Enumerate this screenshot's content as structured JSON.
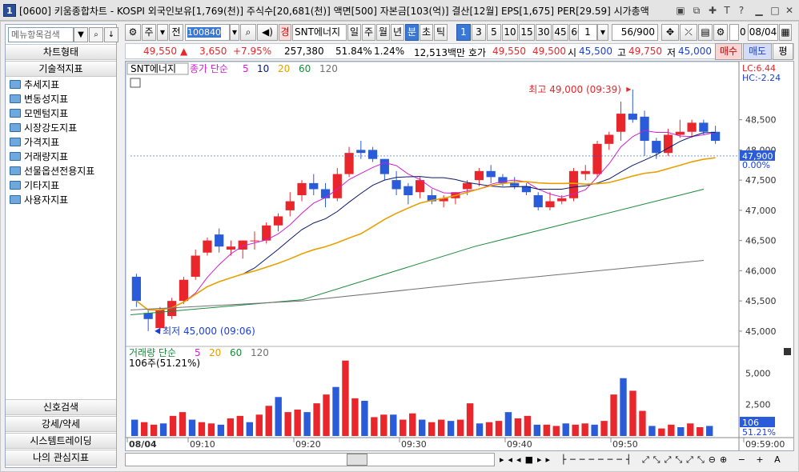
{
  "window": {
    "title": "[0600] 키움종합차트 - KOSPI 외국인보유[1,769(천)] 주식수[20,681(천)] 액면[500] 자본금[103(억)] 결산[12월] EPS[1,675] PER[29.59] 시가총액",
    "icon": "1"
  },
  "sidebar": {
    "search_placeholder": "메뉴항목검색",
    "section_chart_type": "차트형태",
    "section_tech": "기술적지표",
    "items": [
      "추세지표",
      "변동성지표",
      "모멘텀지표",
      "시장강도지표",
      "가격지표",
      "거래량지표",
      "선물옵션전용지표",
      "기타지표",
      "사용자지표"
    ],
    "bottom": [
      "신호검색",
      "강세/약세",
      "시스템트레이딩",
      "나의 관심지표"
    ]
  },
  "toolbar": {
    "period_labels": [
      "주",
      "전"
    ],
    "code": "100840",
    "stock_name": "SNT에너지",
    "gyeong": "경",
    "intervals": [
      "일",
      "주",
      "월",
      "년",
      "분",
      "초",
      "틱"
    ],
    "active_interval": "분",
    "minutes": [
      "1",
      "3",
      "5",
      "10",
      "15",
      "30",
      "45",
      "60"
    ],
    "active_minute": "1",
    "unit": "1",
    "count": "56/900",
    "zero": "0",
    "date": "08/04"
  },
  "quote": {
    "price": "49,550",
    "arrow": "▲",
    "change": "3,650",
    "pct": "+7.95%",
    "volume": "257,380",
    "turnover": "51.84%",
    "ratio": "1.24%",
    "amount": "12,513백만",
    "hoga_label": "호가",
    "ask": "49,550",
    "bid": "49,500",
    "open_label": "시",
    "open": "45,500",
    "high_label": "고",
    "high": "49,750",
    "low_label": "저",
    "low": "45,000",
    "buy": "매수",
    "sell": "매도",
    "eval": "평"
  },
  "chart": {
    "stock": "SNT에너지",
    "legend_label": "종가 단순",
    "ma": [
      "5",
      "10",
      "20",
      "60",
      "120"
    ],
    "ma_colors": [
      "#d020d0",
      "#0a1a6a",
      "#e8a000",
      "#1a8a3a",
      "#707070"
    ],
    "high_annotation": "최고 49,000 (09:39)",
    "low_annotation": "최저 45,000 (09:06)",
    "lc": "LC:6.44",
    "hc": "HC:-2.24",
    "cur_price": "47,900",
    "cur_pct": "0.00%",
    "y_ticks": [
      "48,500",
      "48,000",
      "47,500",
      "47,000",
      "46,500",
      "46,000",
      "45,500",
      "45,000"
    ],
    "vol_legend": "거래량 단순",
    "vol_ma": [
      "5",
      "20",
      "60",
      "120"
    ],
    "vol_note": "106주(51.21%)",
    "vol_ticks": [
      "5,000",
      "2,500"
    ],
    "vol_cur": "106",
    "vol_pct": "51.21%",
    "x_labels": [
      "08/04",
      "09:10",
      "09:20",
      "09:30",
      "09:40",
      "09:50",
      "09:59:00"
    ]
  },
  "chart_data": {
    "type": "candlestick",
    "x_start": "09:04",
    "interval_min": 1,
    "ohlc": [
      [
        45900,
        45950,
        45400,
        45500
      ],
      [
        45300,
        45350,
        45000,
        45200
      ],
      [
        45050,
        45400,
        45000,
        45350
      ],
      [
        45250,
        45550,
        45200,
        45500
      ],
      [
        45500,
        45900,
        45450,
        45850
      ],
      [
        45900,
        46350,
        45850,
        46250
      ],
      [
        46300,
        46550,
        46250,
        46500
      ],
      [
        46600,
        46700,
        46300,
        46400
      ],
      [
        46350,
        46500,
        46250,
        46400
      ],
      [
        46350,
        46500,
        46200,
        46500
      ],
      [
        46500,
        46650,
        46350,
        46500
      ],
      [
        46500,
        46800,
        46450,
        46750
      ],
      [
        46750,
        46950,
        46650,
        46900
      ],
      [
        47000,
        47300,
        46900,
        47150
      ],
      [
        47250,
        47500,
        47150,
        47450
      ],
      [
        47450,
        47600,
        47250,
        47350
      ],
      [
        47350,
        47450,
        47050,
        47200
      ],
      [
        47200,
        47700,
        47150,
        47600
      ],
      [
        47600,
        48050,
        47550,
        47950
      ],
      [
        48000,
        48150,
        47850,
        47950
      ],
      [
        48000,
        48050,
        47800,
        47850
      ],
      [
        47850,
        47850,
        47500,
        47600
      ],
      [
        47500,
        47650,
        47250,
        47350
      ],
      [
        47400,
        47450,
        47100,
        47250
      ],
      [
        47300,
        47550,
        47200,
        47500
      ],
      [
        47250,
        47350,
        47100,
        47150
      ],
      [
        47150,
        47250,
        47050,
        47200
      ],
      [
        47200,
        47300,
        47100,
        47300
      ],
      [
        47350,
        47500,
        47250,
        47450
      ],
      [
        47500,
        47700,
        47400,
        47650
      ],
      [
        47650,
        47750,
        47450,
        47550
      ],
      [
        47550,
        47600,
        47400,
        47450
      ],
      [
        47450,
        47550,
        47350,
        47400
      ],
      [
        47400,
        47450,
        47250,
        47300
      ],
      [
        47250,
        47300,
        47000,
        47050
      ],
      [
        47050,
        47300,
        47000,
        47150
      ],
      [
        47150,
        47250,
        47100,
        47200
      ],
      [
        47200,
        47700,
        47150,
        47650
      ],
      [
        47600,
        47750,
        47500,
        47650
      ],
      [
        47600,
        48150,
        47550,
        48100
      ],
      [
        48100,
        48300,
        48000,
        48250
      ],
      [
        48300,
        48800,
        48150,
        48600
      ],
      [
        48600,
        49000,
        48450,
        48500
      ],
      [
        48550,
        48650,
        47900,
        48150
      ],
      [
        48150,
        48200,
        47850,
        47950
      ],
      [
        47950,
        48350,
        47900,
        48250
      ],
      [
        48250,
        48500,
        48200,
        48300
      ],
      [
        48300,
        48500,
        48200,
        48450
      ],
      [
        48450,
        48500,
        48250,
        48300
      ],
      [
        48300,
        48400,
        48100,
        48150
      ]
    ],
    "volume": [
      1300,
      1100,
      900,
      1000,
      1600,
      1900,
      1300,
      1100,
      1000,
      900,
      1400,
      1600,
      1100,
      1700,
      2400,
      3100,
      1900,
      2100,
      1900,
      2600,
      3300,
      3900,
      6000,
      3000,
      2800,
      1500,
      1700,
      1700,
      1300,
      1800,
      1300,
      1100,
      1300,
      1200,
      1300,
      2600,
      1000,
      1100,
      1200,
      1900,
      1400,
      1600,
      900,
      900,
      800,
      1000,
      900,
      1000,
      900,
      1200,
      3300,
      4600,
      3600,
      2000,
      800,
      600,
      900,
      700,
      1000,
      700,
      800
    ],
    "y_range": [
      44800,
      49250
    ],
    "vol_range": [
      0,
      7000
    ]
  }
}
